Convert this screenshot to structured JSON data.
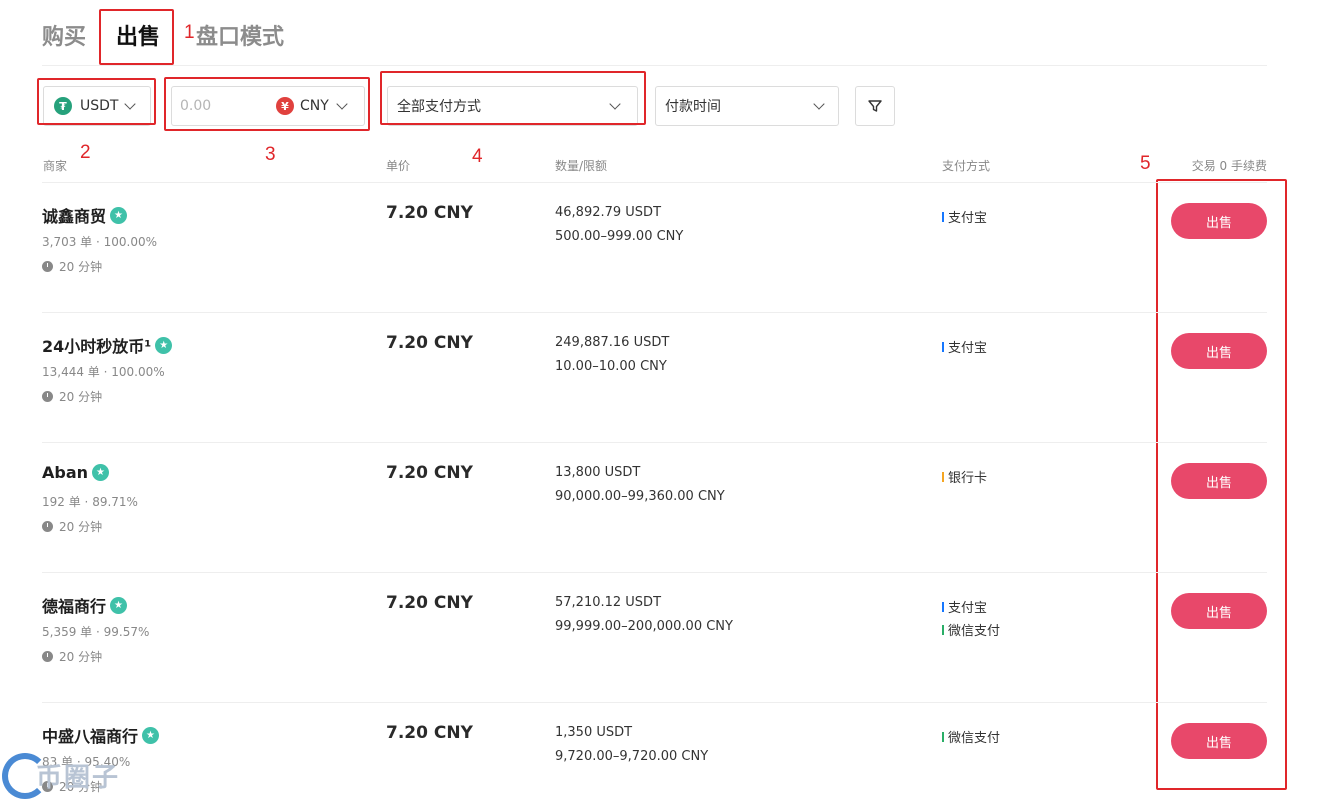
{
  "tabs": {
    "buy": "购买",
    "sell": "出售",
    "orderbook": "盘口模式"
  },
  "filters": {
    "coin": "USDT",
    "coin_icon": "tether-icon",
    "amount_placeholder": "0.00",
    "currency": "CNY",
    "currency_icon": "yuan-icon",
    "payment": "全部支付方式",
    "pay_time": "付款时间"
  },
  "annotations": [
    "1",
    "2",
    "3",
    "4",
    "5"
  ],
  "table": {
    "headers": {
      "merchant": "商家",
      "price": "单价",
      "quantity": "数量/限额",
      "payment": "支付方式",
      "fee": "交易 0 手续费"
    },
    "rows": [
      {
        "merchant": "诚鑫商贸",
        "orders": "3,703 单",
        "rate": "100.00%",
        "time": "20 分钟",
        "price": "7.20 CNY",
        "quantity": "46,892.79 USDT",
        "limit": "500.00–999.00 CNY",
        "payments": [
          {
            "name": "支付宝",
            "color": "#1677ff"
          }
        ],
        "action": "出售"
      },
      {
        "merchant": "24小时秒放币¹",
        "orders": "13,444 单",
        "rate": "100.00%",
        "time": "20 分钟",
        "price": "7.20 CNY",
        "quantity": "249,887.16 USDT",
        "limit": "10.00–10.00 CNY",
        "payments": [
          {
            "name": "支付宝",
            "color": "#1677ff"
          }
        ],
        "action": "出售"
      },
      {
        "merchant": "Aban",
        "orders": "192 单",
        "rate": "89.71%",
        "time": "20 分钟",
        "price": "7.20 CNY",
        "quantity": "13,800 USDT",
        "limit": "90,000.00–99,360.00 CNY",
        "payments": [
          {
            "name": "银行卡",
            "color": "#f5a623"
          }
        ],
        "action": "出售"
      },
      {
        "merchant": "德福商行",
        "orders": "5,359 单",
        "rate": "99.57%",
        "time": "20 分钟",
        "price": "7.20 CNY",
        "quantity": "57,210.12 USDT",
        "limit": "99,999.00–200,000.00 CNY",
        "payments": [
          {
            "name": "支付宝",
            "color": "#1677ff"
          },
          {
            "name": "微信支付",
            "color": "#2aae67"
          }
        ],
        "action": "出售"
      },
      {
        "merchant": "中盛八福商行",
        "orders": "83 单",
        "rate": "95.40%",
        "time": "20 分钟",
        "price": "7.20 CNY",
        "quantity": "1,350 USDT",
        "limit": "9,720.00–9,720.00 CNY",
        "payments": [
          {
            "name": "微信支付",
            "color": "#2aae67"
          }
        ],
        "action": "出售"
      }
    ]
  },
  "watermark": "币圈子"
}
